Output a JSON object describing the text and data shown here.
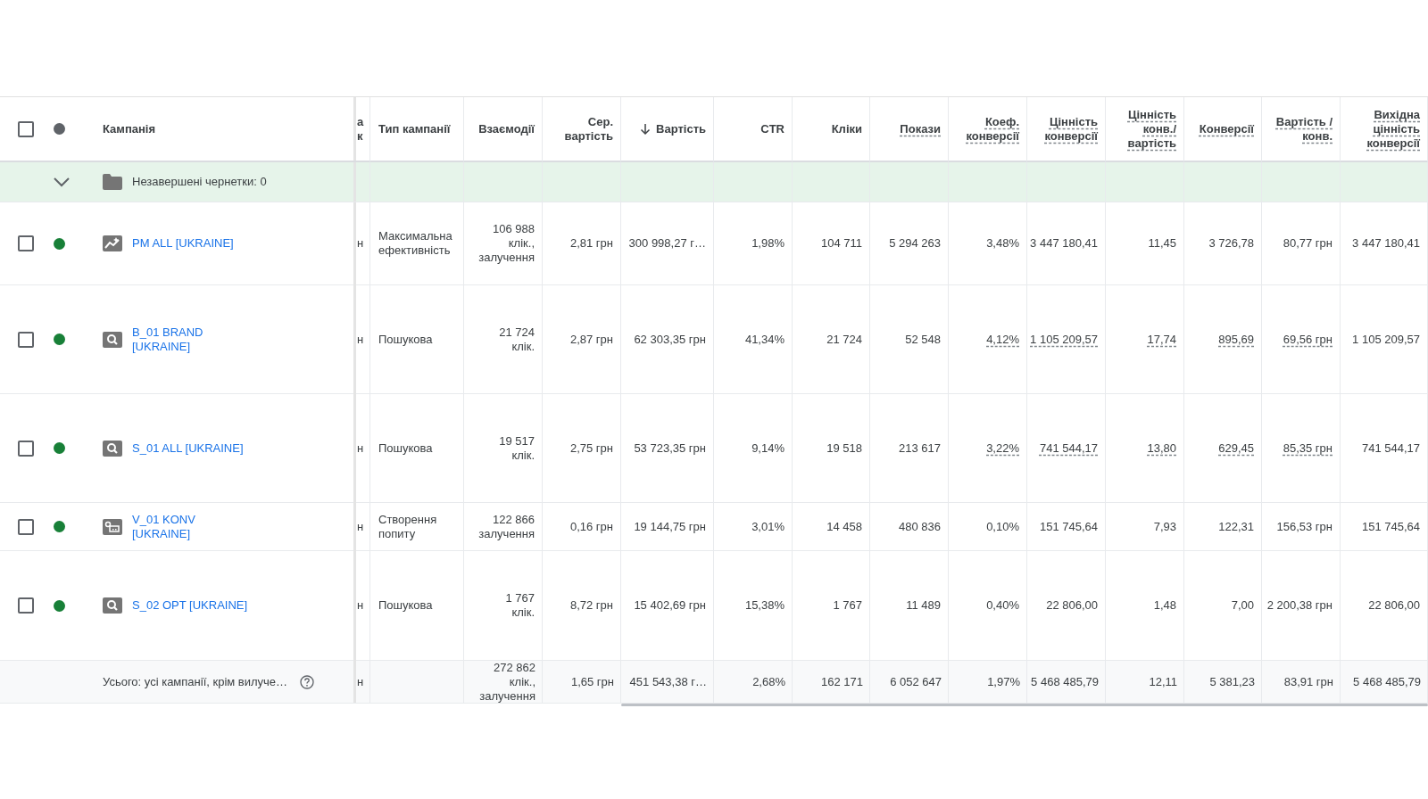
{
  "header": {
    "checked": false,
    "campaign_label": "Кампанія",
    "columns": [
      {
        "label": "а к",
        "dashed": false,
        "cell_hint": false,
        "sorted": false
      },
      {
        "label": "Тип кампанії",
        "dashed": false,
        "cell_hint": false,
        "sorted": false
      },
      {
        "label": "Взаємодії",
        "dashed": false,
        "cell_hint": false,
        "sorted": false
      },
      {
        "label": "Сер. вартість",
        "dashed": false,
        "cell_hint": false,
        "sorted": false
      },
      {
        "label": "Вартість",
        "dashed": false,
        "cell_hint": false,
        "sorted": true
      },
      {
        "label": "CTR",
        "dashed": false,
        "cell_hint": false,
        "sorted": false
      },
      {
        "label": "Кліки",
        "dashed": false,
        "cell_hint": false,
        "sorted": false
      },
      {
        "label": "Покази",
        "dashed": true,
        "cell_hint": false,
        "sorted": false
      },
      {
        "label": "Коеф. конверсії",
        "dashed": true,
        "cell_hint": true,
        "sorted": false
      },
      {
        "label": "Цінність конверсії",
        "dashed": true,
        "cell_hint": true,
        "sorted": false
      },
      {
        "label": "Цінність конв./ вартість",
        "dashed": true,
        "cell_hint": true,
        "sorted": false
      },
      {
        "label": "Конверсії",
        "dashed": true,
        "cell_hint": true,
        "sorted": false
      },
      {
        "label": "Вартість / конв.",
        "dashed": true,
        "cell_hint": true,
        "sorted": false
      },
      {
        "label": "Вихідна цінність конверсії",
        "dashed": true,
        "cell_hint": false,
        "sorted": false
      }
    ]
  },
  "drafts": {
    "label": "Незавершені чернетки: 0",
    "expanded": true
  },
  "rows": [
    {
      "checked": false,
      "color": "#188038",
      "kind": "performance_max",
      "name": "PM ALL [UKRAINE]",
      "hint_underline": false,
      "values": [
        "н",
        "Максимальна ефективність",
        "106 988 клік., залучення",
        "2,81 грн",
        "300 998,27 г…",
        "1,98%",
        "104 711",
        "5 294 263",
        "3,48%",
        "3 447 180,41",
        "11,45",
        "3 726,78",
        "80,77 грн",
        "3 447 180,41"
      ]
    },
    {
      "checked": false,
      "color": "#188038",
      "kind": "search",
      "name": "B_01 BRAND [UKRAINE]",
      "hint_underline": true,
      "values": [
        "н",
        "Пошукова",
        "21 724 клік.",
        "2,87 грн",
        "62 303,35 грн",
        "41,34%",
        "21 724",
        "52 548",
        "4,12%",
        "1 105 209,57",
        "17,74",
        "895,69",
        "69,56 грн",
        "1 105 209,57"
      ]
    },
    {
      "checked": false,
      "color": "#188038",
      "kind": "search",
      "name": "S_01 ALL [UKRAINE]",
      "hint_underline": true,
      "values": [
        "н",
        "Пошукова",
        "19 517 клік.",
        "2,75 грн",
        "53 723,35 грн",
        "9,14%",
        "19 518",
        "213 617",
        "3,22%",
        "741 544,17",
        "13,80",
        "629,45",
        "85,35 грн",
        "741 544,17"
      ]
    },
    {
      "checked": false,
      "color": "#188038",
      "kind": "video",
      "name": "V_01 KONV [UKRAINE]",
      "hint_underline": false,
      "values": [
        "н",
        "Створення попиту",
        "122 866 залучення",
        "0,16 грн",
        "19 144,75 грн",
        "3,01%",
        "14 458",
        "480 836",
        "0,10%",
        "151 745,64",
        "7,93",
        "122,31",
        "156,53 грн",
        "151 745,64"
      ]
    },
    {
      "checked": false,
      "color": "#188038",
      "kind": "search",
      "name": "S_02 OPT [UKRAINE]",
      "hint_underline": false,
      "values": [
        "н",
        "Пошукова",
        "1 767 клік.",
        "8,72 грн",
        "15 402,69 грн",
        "15,38%",
        "1 767",
        "11 489",
        "0,40%",
        "22 806,00",
        "1,48",
        "7,00",
        "2 200,38 грн",
        "22 806,00"
      ]
    }
  ],
  "total": {
    "label": "Усього: усі кампанії, крім вилуче…",
    "marker": "н",
    "values": [
      "272 862 клік., залучення",
      "1,65 грн",
      "451 543,38 г…",
      "2,68%",
      "162 171",
      "6 052 647",
      "1,97%",
      "5 468 485,79",
      "12,11",
      "5 381,23",
      "83,91 грн",
      "5 468 485,79"
    ]
  }
}
